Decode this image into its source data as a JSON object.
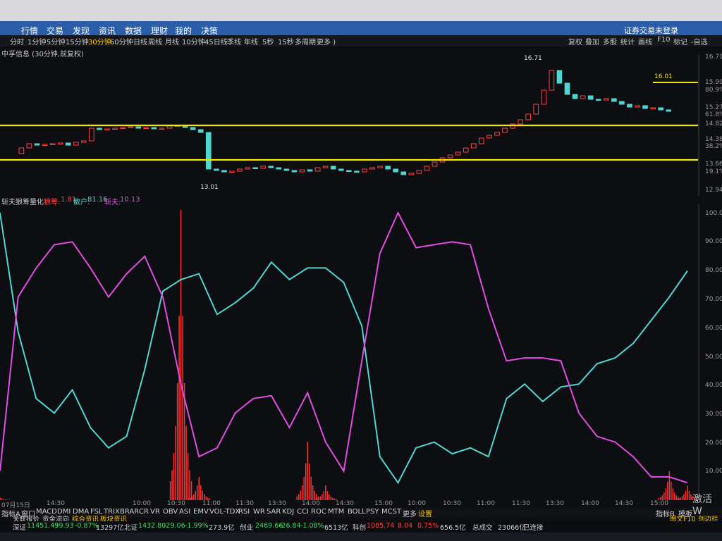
{
  "menu": {
    "items": [
      "行情",
      "交易",
      "发现",
      "资讯",
      "数据",
      "理财",
      "我的",
      "决策"
    ],
    "login": "证券交易未登录"
  },
  "toolbar": {
    "periods": [
      "分时",
      "1分钟",
      "5分钟",
      "15分钟",
      "30分钟",
      "60分钟",
      "日线",
      "周线",
      "月线",
      "10分钟",
      "45日线",
      "季线",
      "年线",
      "5秒",
      "15秒",
      "多周期",
      "更多 )"
    ],
    "selected_period": "30分钟",
    "right_items": [
      "复权",
      "叠加",
      "多股",
      "统计",
      "画线",
      "F10",
      "标记",
      "-自选"
    ]
  },
  "stock": {
    "title": "中孚信息 (30分钟,前复权)"
  },
  "price_axis": {
    "labels": [
      "16.71",
      "15.99",
      "80.9%",
      "15.27",
      "61.8%",
      "14.82",
      "14.38",
      "38.2%",
      "13.66",
      "19.1%",
      "12.94"
    ]
  },
  "annotations": {
    "high": "16.71",
    "low": "13.01",
    "line_label": "16.01"
  },
  "indicator": {
    "name": "斩夫狼筹量化",
    "series": [
      {
        "label": "狼筹:",
        "value": "1.81",
        "color": "#ff4a4a"
      },
      {
        "label": "散户:",
        "value": "81.16",
        "color": "#4fd6d0"
      },
      {
        "label": "斩夫:",
        "value": "10.13",
        "color": "#e04de0"
      }
    ]
  },
  "indicator_axis": {
    "labels": [
      "100.0",
      "90.00",
      "80.00",
      "70.00",
      "60.00",
      "50.00",
      "40.00",
      "30.00",
      "20.00",
      "10.00"
    ]
  },
  "time_axis": {
    "labels": [
      "07月15日",
      "14:30",
      "10:00",
      "10:30",
      "11:00",
      "11:30",
      "13:30",
      "14:00",
      "14:30",
      "15:00",
      "10:00",
      "10:30",
      "11:00",
      "11:30",
      "13:30",
      "14:00",
      "14:30",
      "15:00"
    ]
  },
  "indicator_tabs": {
    "items": [
      "指标A",
      "窗口",
      "MACD",
      "DMI",
      "DMA",
      "FSL",
      "TRIX",
      "BRAR",
      "CR",
      "VR",
      "OBV",
      "ASI",
      "EMV",
      "VOL-TDX",
      "RSI",
      "WR",
      "SAR",
      "KDJ",
      "CCI",
      "ROC",
      "MTM",
      "BOLL",
      "PSY",
      "MCST",
      "更多",
      "设置"
    ],
    "right": [
      "指标B",
      "模板"
    ]
  },
  "subtabs": {
    "items": [
      "关联报价",
      "资金流向",
      "综合资讯",
      "板块资讯"
    ],
    "right": [
      "图文F10",
      "创边栏"
    ]
  },
  "status": {
    "items": [
      {
        "label": "深证",
        "value": "11451.43",
        "chg": "-99.93",
        "pct": "-0.87%",
        "vol": "13297亿"
      },
      {
        "label": "北证",
        "value": "1432.80",
        "chg": "-29.06",
        "pct": "-1.99%",
        "vol": "273.9亿"
      },
      {
        "label": "创业",
        "value": "2469.66",
        "chg": "-26.84",
        "pct": "-1.08%",
        "vol": "6513亿"
      },
      {
        "label": "科创",
        "value": "1085.74",
        "chg": "8.04",
        "pct": "0.75%",
        "vol": "656.5亿"
      }
    ],
    "total_label": "总成交",
    "total_value": "23066亿",
    "connection": "已连接"
  },
  "watermark": "激活 W",
  "colors": {
    "up": "#ff4040",
    "down": "#4fd6d0",
    "highlight": "#f5e600",
    "magenta": "#e04de0",
    "cyan": "#4fd6d0",
    "red": "#ff3030"
  },
  "chart_data": {
    "type": "line",
    "title": "斩夫狼筹量化",
    "ylim": [
      0,
      100
    ],
    "series": [
      {
        "name": "散户",
        "values": [
          99,
          58,
          35,
          30,
          38,
          25,
          18,
          22,
          45,
          72,
          76,
          78,
          64,
          68,
          73,
          82,
          76,
          80,
          80,
          75,
          60,
          15,
          6,
          18,
          20,
          16,
          18,
          15,
          35,
          40,
          34,
          39,
          40,
          47,
          49,
          54,
          62,
          70,
          79
        ]
      },
      {
        "name": "斩夫",
        "values": [
          10,
          70,
          80,
          88,
          89,
          80,
          70,
          78,
          84,
          70,
          40,
          15,
          18,
          30,
          35,
          36,
          25,
          37,
          20,
          10,
          48,
          85,
          99,
          87,
          88,
          89,
          88,
          66,
          48,
          49,
          49,
          48,
          30,
          22,
          20,
          15,
          8,
          8,
          6
        ]
      },
      {
        "name": "狼筹",
        "values": [
          1,
          0,
          0,
          0,
          0,
          0,
          0,
          0,
          0,
          0,
          100,
          8,
          0,
          0,
          0,
          0,
          0,
          20,
          5,
          0,
          0,
          0,
          0,
          0,
          0,
          0,
          0,
          0,
          0,
          0,
          0,
          0,
          0,
          0,
          0,
          0,
          0,
          10,
          5
        ]
      }
    ]
  }
}
